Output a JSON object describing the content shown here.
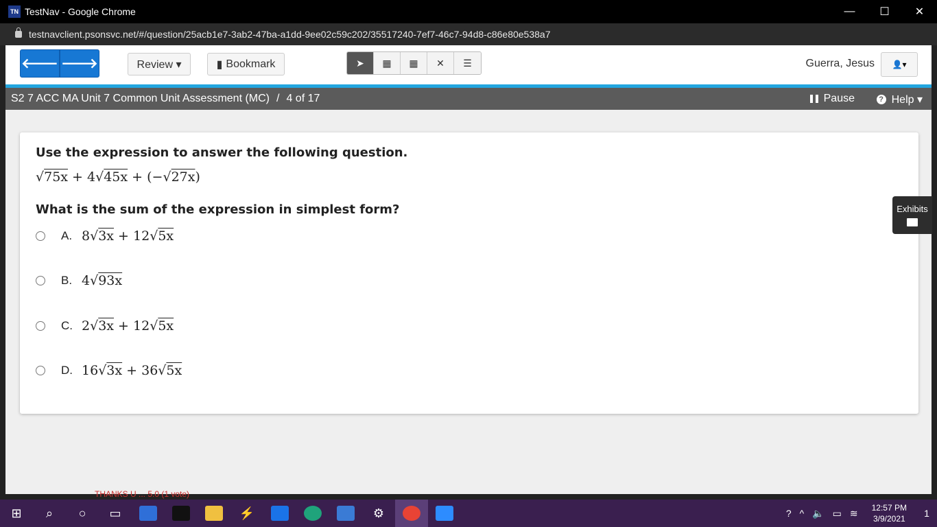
{
  "window": {
    "title": "TestNav - Google Chrome",
    "app_icon": "TN",
    "minimize": "—",
    "maximize": "☐",
    "close": "✕"
  },
  "address_bar": {
    "url": "testnavclient.psonsvc.net/#/question/25acb1e7-3ab2-47ba-a1dd-9ee02c59c202/35517240-7ef7-46c7-94d8-c86e80e538a7"
  },
  "toolbar": {
    "review_label": "Review ▾",
    "bookmark_label": "Bookmark",
    "user_name": "Guerra, Jesus",
    "back_arrow": "🡐",
    "next_arrow": "🡒",
    "tools": [
      "pointer-icon",
      "calculator-icon",
      "scientific-calculator-icon",
      "answer-eliminator-icon",
      "notepad-icon"
    ]
  },
  "header": {
    "test_title": "S2 7 ACC MA Unit 7 Common Unit Assessment (MC)",
    "separator": "/",
    "progress": "4 of 17",
    "pause_label": "Pause",
    "help_label": "Help ▾"
  },
  "question": {
    "instruction": "Use the expression to answer the following question.",
    "expression": {
      "parts": [
        "√",
        "75x",
        " + 4",
        "√",
        "45x",
        " + (−",
        "√",
        "27x",
        ")"
      ]
    },
    "prompt": "What is the sum of the expression in simplest form?",
    "choices": [
      {
        "letter": "A.",
        "coef1": "8",
        "rad1": "3x",
        "op": " + 12",
        "rad2": "5x"
      },
      {
        "letter": "B.",
        "coef1": "4",
        "rad1": "93x",
        "op": "",
        "rad2": ""
      },
      {
        "letter": "C.",
        "coef1": "2",
        "rad1": "3x",
        "op": " + 12",
        "rad2": "5x"
      },
      {
        "letter": "D.",
        "coef1": "16",
        "rad1": "3x",
        "op": " + 36",
        "rad2": "5x"
      }
    ]
  },
  "exhibits": {
    "label": "Exhibits"
  },
  "background_bleed": {
    "text": "THANKS U ... 5.0 (1 vote)"
  },
  "taskbar": {
    "time": "12:57 PM",
    "date": "3/9/2021",
    "notification_count": "1"
  }
}
